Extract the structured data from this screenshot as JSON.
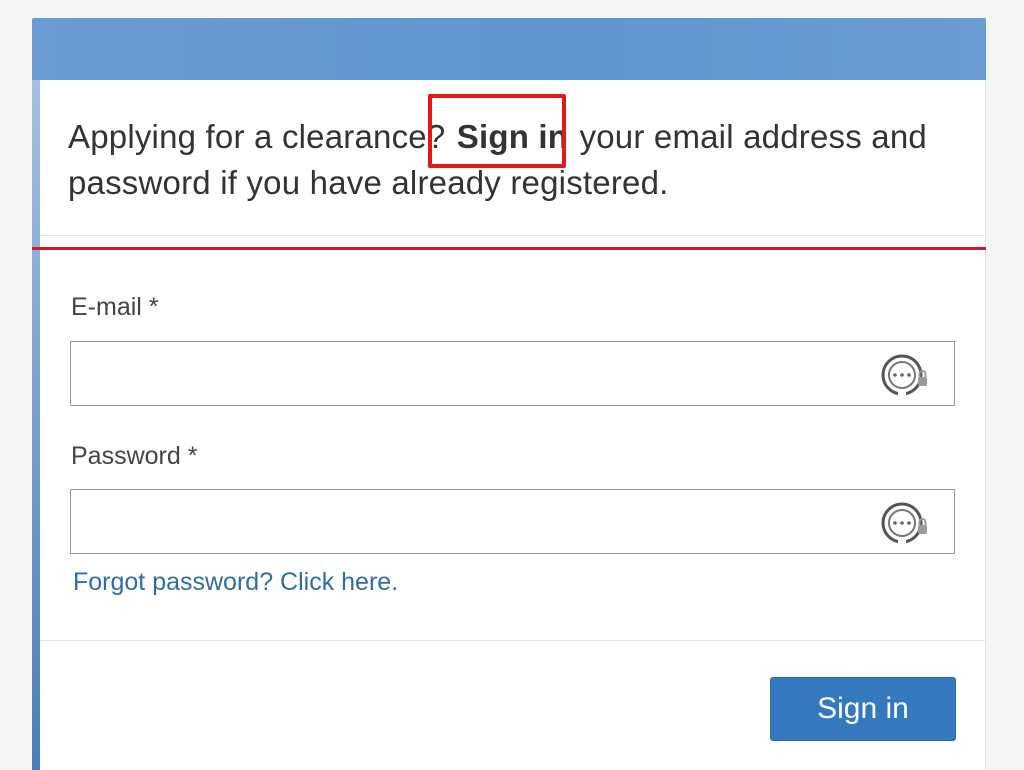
{
  "intro": {
    "prefix": "Applying for a clearance? ",
    "strong": "Sign in",
    "suffix": " your email address and password if you have already registered."
  },
  "form": {
    "email_label": "E-mail *",
    "email_value": "",
    "email_placeholder": "",
    "password_label": "Password *",
    "password_value": "",
    "password_placeholder": "",
    "forgot_link": "Forgot password? Click here.",
    "submit_label": "Sign in"
  },
  "icons": {
    "field_icon": "password-manager-lock-icon"
  },
  "colors": {
    "header_band": "#6b9bd2",
    "accent_red": "#c92027",
    "highlight_red": "#e01919",
    "link_blue": "#2f6ea3",
    "button_blue": "#3478bd"
  }
}
